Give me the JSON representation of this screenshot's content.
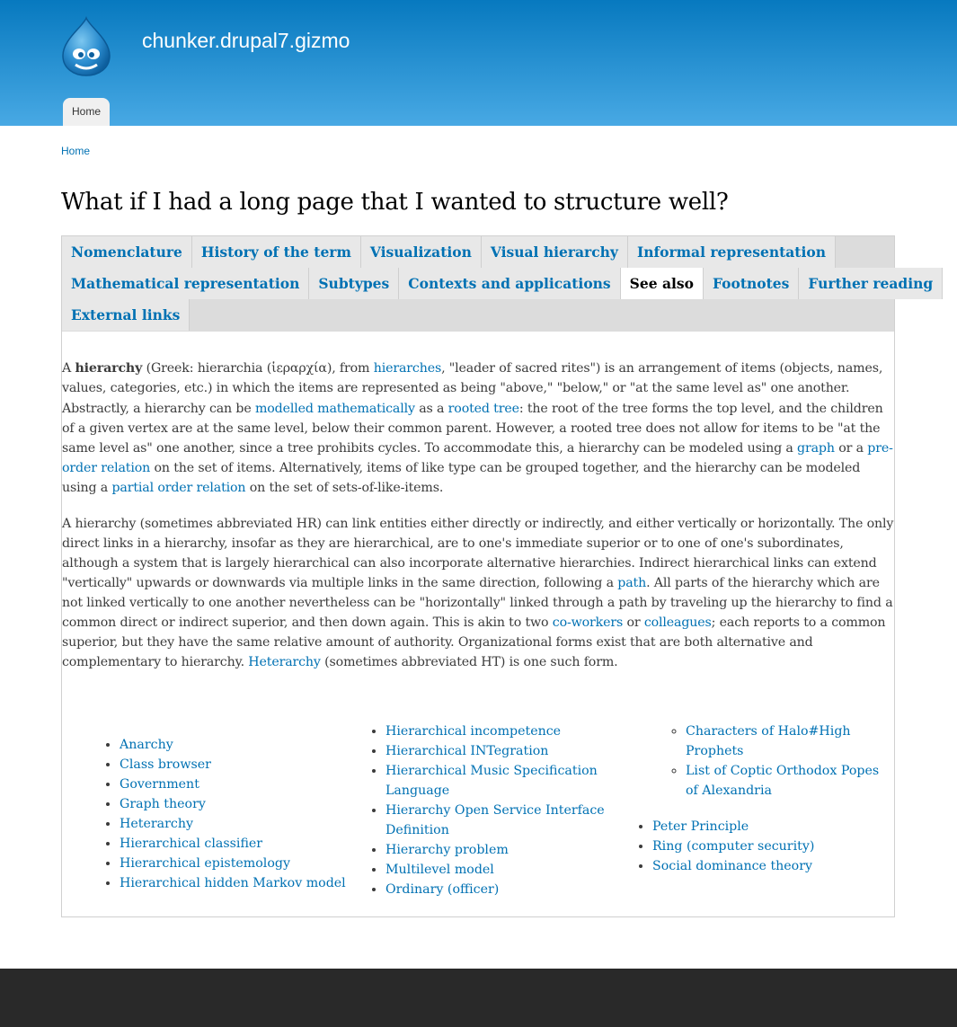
{
  "site": {
    "name": "chunker.drupal7.gizmo",
    "menu_home": "Home"
  },
  "breadcrumb": {
    "home": "Home"
  },
  "page": {
    "title": "What if I had a long page that I wanted to structure well?"
  },
  "tabs": {
    "row1": [
      "Nomenclature",
      "History of the term",
      "Visualization",
      "Visual hierarchy",
      "Informal representation"
    ],
    "row2": [
      "Mathematical representation",
      "Subtypes",
      "Contexts and applications",
      "See also",
      "Footnotes",
      "Further reading"
    ],
    "row3": [
      "External links"
    ],
    "active": "See also"
  },
  "content": {
    "p1": {
      "t1": "A ",
      "bold": "hierarchy",
      "t2": " (Greek: hierarchia (ἱεραρχία), from ",
      "link1": "hierarches",
      "t3": ", \"leader of sacred rites\") is an arrangement of items (objects, names, values, categories, etc.) in which the items are represented as being \"above,\" \"below,\" or \"at the same level as\" one another."
    },
    "p2": {
      "t1": "Abstractly, a hierarchy can be ",
      "link1": "modelled mathematically",
      "t2": " as a ",
      "link2": "rooted tree",
      "t3": ": the root of the tree forms the top level, and the children of a given vertex are at the same level, below their common parent. However, a rooted tree does not allow for items to be \"at the same level as\" one another, since a tree prohibits cycles. To accommodate this, a hierarchy can be modeled using a ",
      "link3": "graph",
      "t4": " or a ",
      "link4": "pre-order relation",
      "t5": " on the set of items. Alternatively, items of like type can be grouped together, and the hierarchy can be modeled using a ",
      "link5": "partial order relation",
      "t6": " on the set of sets-of-like-items."
    },
    "p3": {
      "t1": "A hierarchy (sometimes abbreviated HR) can link entities either directly or indirectly, and either vertically or horizontally. The only direct links in a hierarchy, insofar as they are hierarchical, are to one's immediate superior or to one of one's subordinates, although a system that is largely hierarchical can also incorporate alternative hierarchies. Indirect hierarchical links can extend \"vertically\" upwards or downwards via multiple links in the same direction, following a ",
      "link1": "path",
      "t2": ". All parts of the hierarchy which are not linked vertically to one another nevertheless can be \"horizontally\" linked through a path by traveling up the hierarchy to find a common direct or indirect superior, and then down again. This is akin to two ",
      "link2": "co-workers",
      "t3": " or ",
      "link3": "colleagues",
      "t4": "; each reports to a common superior, but they have the same relative amount of authority. Organizational forms exist that are both alternative and complementary to hierarchy. ",
      "link4": "Heterarchy",
      "t5": " (sometimes abbreviated HT) is one such form."
    }
  },
  "see_also": {
    "col1": [
      "Anarchy",
      "Class browser",
      "Government",
      "Graph theory",
      "Heterarchy",
      "Hierarchical classifier",
      "Hierarchical epistemology",
      "Hierarchical hidden Markov model"
    ],
    "col2": [
      "Hierarchical incompetence",
      "Hierarchical INTegration",
      "Hierarchical Music Specification Language",
      "Hierarchy Open Service Interface Definition",
      "Hierarchy problem",
      "Multilevel model",
      "Ordinary (officer)"
    ],
    "col3_sub": [
      "Characters of Halo#High Prophets",
      "List of Coptic Orthodox Popes of Alexandria"
    ],
    "col3": [
      "Peter Principle",
      "Ring (computer security)",
      "Social dominance theory"
    ]
  },
  "colors": {
    "header_top": "#0779bf",
    "header_bottom": "#48a9e4",
    "link": "#0071b3",
    "tab_bar": "#dcdcdc",
    "footer": "#292929"
  },
  "icons": {
    "logo": "drupal-drop-logo"
  }
}
